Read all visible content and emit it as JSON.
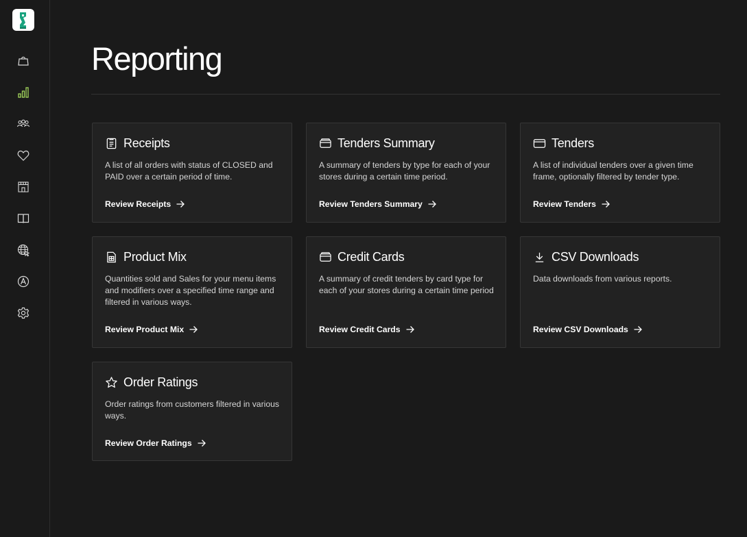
{
  "page": {
    "title": "Reporting"
  },
  "sidebar": {
    "items": [
      {
        "icon": "shopping-bag-icon",
        "active": false
      },
      {
        "icon": "bar-chart-icon",
        "active": true
      },
      {
        "icon": "people-icon",
        "active": false
      },
      {
        "icon": "heart-icon",
        "active": false
      },
      {
        "icon": "storefront-icon",
        "active": false
      },
      {
        "icon": "book-icon",
        "active": false
      },
      {
        "icon": "globe-icon",
        "active": false
      },
      {
        "icon": "app-icon",
        "active": false
      },
      {
        "icon": "gear-icon",
        "active": false
      }
    ]
  },
  "colors": {
    "background": "#1a1a1a",
    "card": "#222222",
    "card_border": "#363636",
    "active_icon": "#a3d65c",
    "icon": "#d8d8d8",
    "brand": "#1aa37f"
  },
  "cards": [
    {
      "icon": "receipt-icon",
      "title": "Receipts",
      "description": "A list of all orders with status of CLOSED and PAID over a certain period of time.",
      "link": "Review Receipts"
    },
    {
      "icon": "wallet-icon",
      "title": "Tenders Summary",
      "description": "A summary of tenders by type for each of your stores during a certain time period.",
      "link": "Review Tenders Summary"
    },
    {
      "icon": "card-icon",
      "title": "Tenders",
      "description": "A list of individual tenders over a given time frame, optionally filtered by tender type.",
      "link": "Review Tenders"
    },
    {
      "icon": "spreadsheet-icon",
      "title": "Product Mix",
      "description": "Quantities sold and Sales for your menu items and modifiers over a specified time range and filtered in various ways.",
      "link": "Review Product Mix"
    },
    {
      "icon": "wallet-icon",
      "title": "Credit Cards",
      "description": "A summary of credit tenders by card type for each of your stores during a certain time period",
      "link": "Review Credit Cards"
    },
    {
      "icon": "download-icon",
      "title": "CSV Downloads",
      "description": "Data downloads from various reports.",
      "link": "Review CSV Downloads"
    },
    {
      "icon": "star-icon",
      "title": "Order Ratings",
      "description": "Order ratings from customers filtered in various ways.",
      "link": "Review Order Ratings"
    }
  ]
}
